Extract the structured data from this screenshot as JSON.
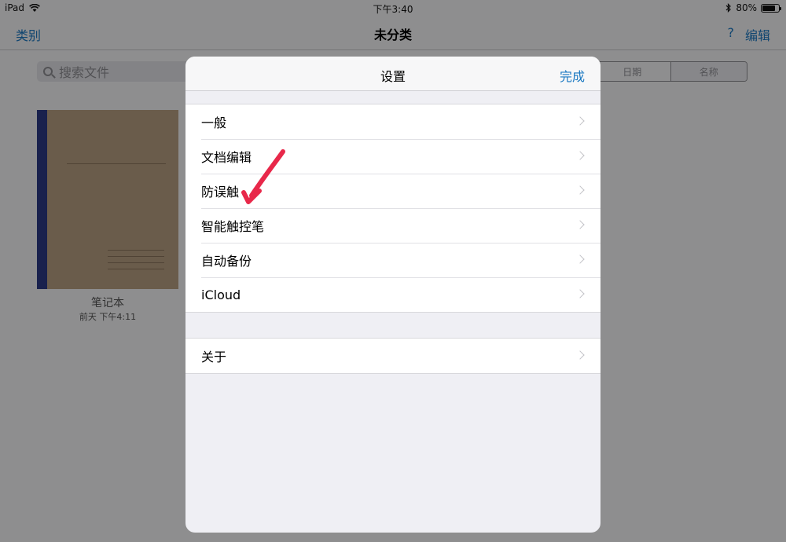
{
  "status_bar": {
    "device": "iPad",
    "time": "下午3:40",
    "battery": "80%",
    "battery_level": 0.8
  },
  "navbar": {
    "left": "类别",
    "title": "未分类",
    "help": "?",
    "edit": "编辑"
  },
  "search": {
    "placeholder": "搜索文件"
  },
  "sort": {
    "options": [
      "日期",
      "名称"
    ],
    "selected": "名称"
  },
  "notebook": {
    "title": "笔记本",
    "time": "前天 下午4:11"
  },
  "modal": {
    "title": "设置",
    "done": "完成",
    "group1": [
      "一般",
      "文档编辑",
      "防误触",
      "智能触控笔",
      "自动备份",
      "iCloud"
    ],
    "group2": [
      "关于"
    ]
  },
  "colors": {
    "accent": "#1a78c2",
    "annotation_arrow": "#e8284a",
    "notebook_cover": "#b79f82",
    "notebook_spine": "#2c3a86"
  }
}
